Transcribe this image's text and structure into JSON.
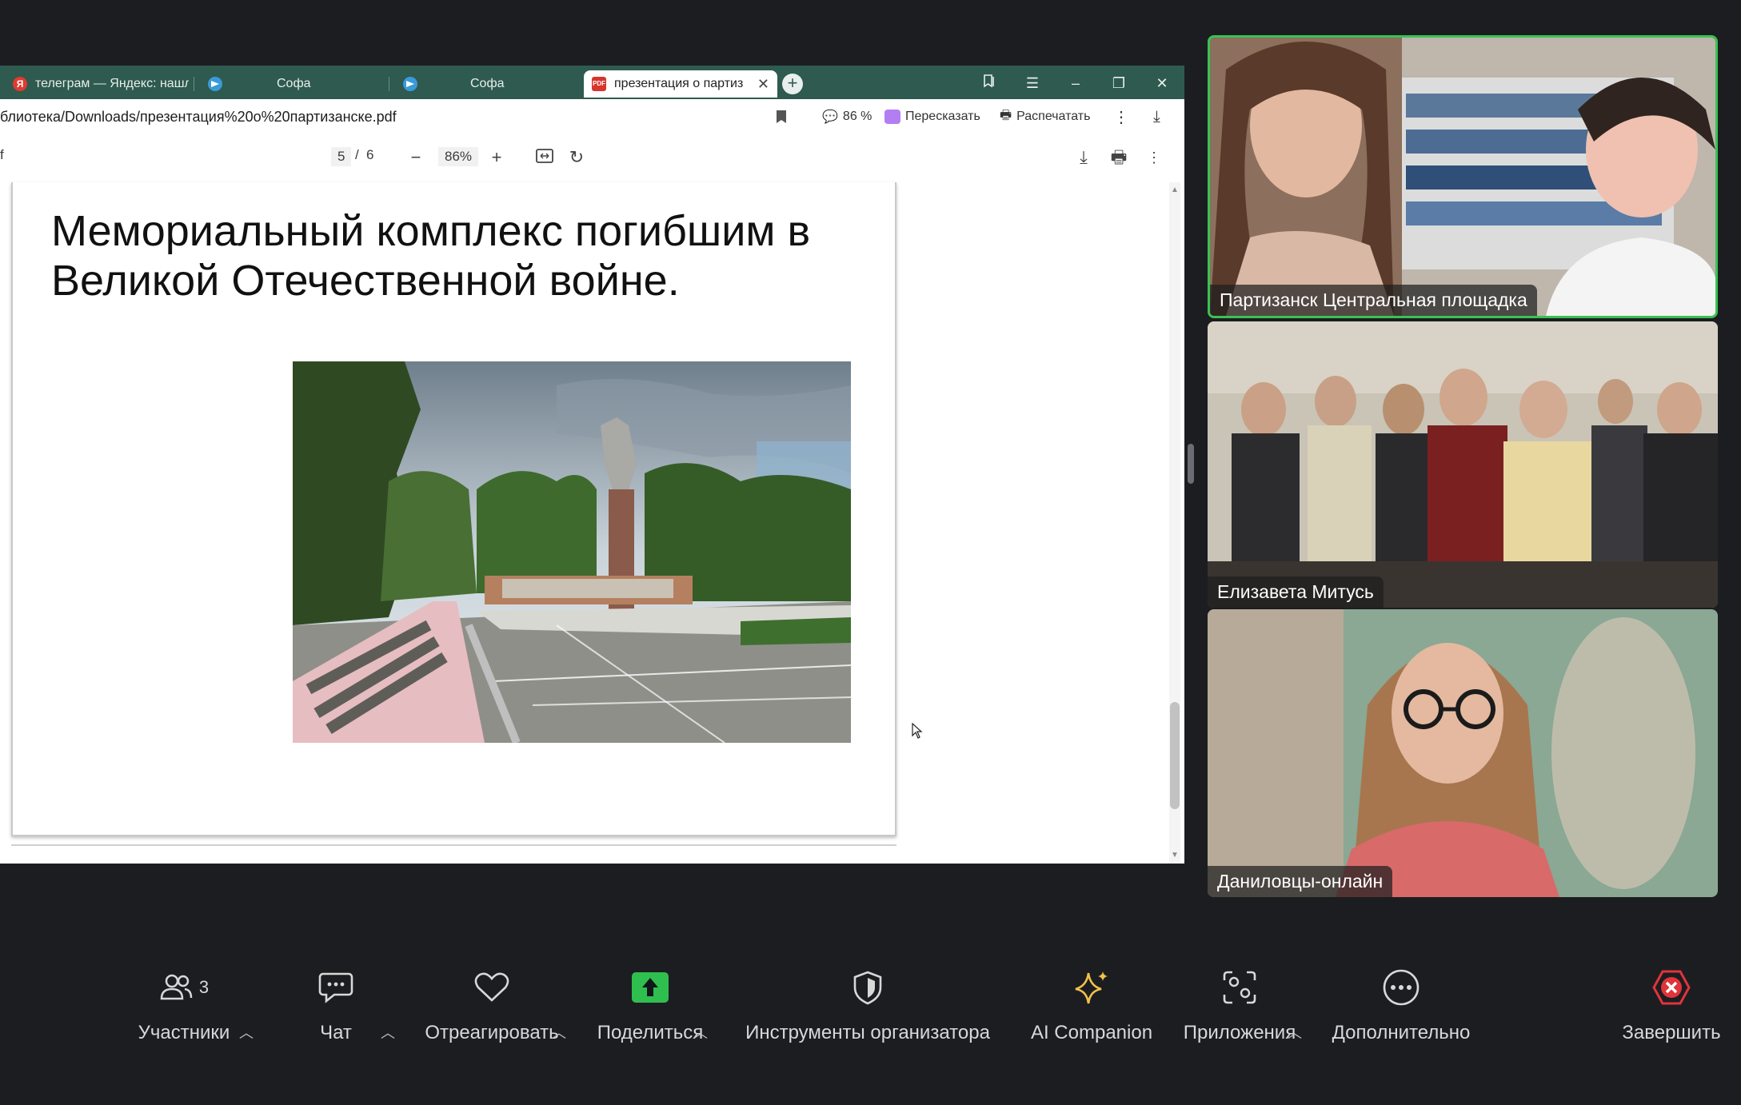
{
  "browser": {
    "tabs": [
      {
        "label": "телеграм — Яндекс: нашл",
        "icon": "yandex-icon"
      },
      {
        "label": "Софа",
        "icon": "telegram-icon"
      },
      {
        "label": "Софа",
        "icon": "telegram-icon"
      },
      {
        "label": "презентация о партиз",
        "icon": "pdf-icon",
        "active": true
      }
    ],
    "url": "блиотека/Downloads/презентация%20о%20партизанске.pdf",
    "comments_label": "86 %",
    "retell_label": "Пересказать",
    "print_label": "Распечатать"
  },
  "pdf": {
    "page_current": "5",
    "page_sep": "/",
    "page_total": "6",
    "zoom": "86%",
    "left_stub": "f",
    "slide_title": "Мемориальный комплекс погибшим в Великой Отечественной войне."
  },
  "video": {
    "participants": [
      {
        "name": "Партизанск Центральная площадка",
        "active_speaker": true
      },
      {
        "name": "Елизавета Митусь"
      },
      {
        "name": "Даниловцы-онлайн"
      }
    ]
  },
  "toolbar": {
    "participants_label": "Участники",
    "participants_count": "3",
    "chat_label": "Чат",
    "react_label": "Отреагировать",
    "share_label": "Поделиться",
    "host_tools_label": "Инструменты организатора",
    "ai_label": "AI Companion",
    "apps_label": "Приложения",
    "more_label": "Дополнительно",
    "end_label": "Завершить"
  },
  "colors": {
    "browser_tab_bar": "#2e5a4f",
    "active_speaker_border": "#39c254",
    "share_green": "#2fbf4f",
    "end_red": "#e0343a",
    "ai_gold": "#f0c24a"
  }
}
